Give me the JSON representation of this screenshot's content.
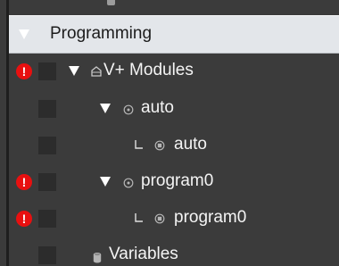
{
  "tree": {
    "header": {
      "label": "Programming",
      "expanded": true
    },
    "items": [
      {
        "label": "V+ Modules",
        "icon": "folder-icon",
        "indent": 1,
        "expanded": true,
        "error": true
      },
      {
        "label": "auto",
        "icon": "module-icon",
        "indent": 2,
        "expanded": true,
        "error": false
      },
      {
        "label": "auto",
        "icon": "program-icon",
        "indent": 3,
        "connector": "L",
        "error": false
      },
      {
        "label": "program0",
        "icon": "module-icon",
        "indent": 2,
        "expanded": true,
        "error": true
      },
      {
        "label": "program0",
        "icon": "program-icon",
        "indent": 3,
        "connector": "L",
        "error": true
      },
      {
        "label": "Variables",
        "icon": "database-icon",
        "indent": 2,
        "error": false
      }
    ],
    "error_glyph": "!",
    "colors": {
      "background": "#3b3b3b",
      "header_bg": "#e3e6ea",
      "error": "#e81010",
      "text": "#f4f4f4"
    }
  }
}
